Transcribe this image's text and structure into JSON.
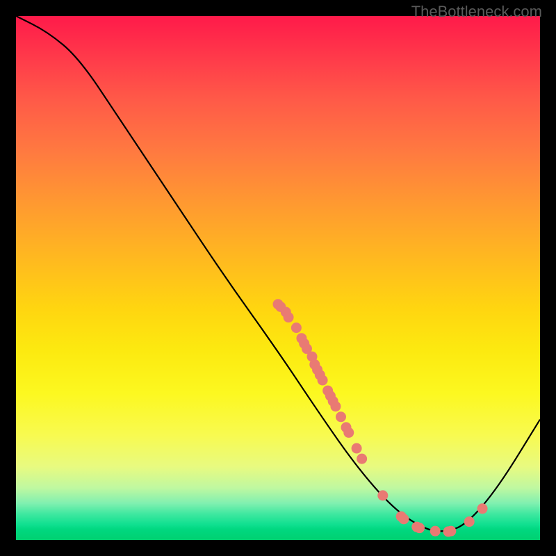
{
  "watermark": "TheBottleneck.com",
  "chart_data": {
    "type": "line",
    "title": "",
    "xlabel": "",
    "ylabel": "",
    "xlim": [
      0,
      100
    ],
    "ylim": [
      0,
      100
    ],
    "curve": [
      {
        "x": 0,
        "y": 100
      },
      {
        "x": 6,
        "y": 97
      },
      {
        "x": 12,
        "y": 92
      },
      {
        "x": 20,
        "y": 80
      },
      {
        "x": 30,
        "y": 65
      },
      {
        "x": 40,
        "y": 50
      },
      {
        "x": 50,
        "y": 36
      },
      {
        "x": 58,
        "y": 24
      },
      {
        "x": 65,
        "y": 14
      },
      {
        "x": 72,
        "y": 6
      },
      {
        "x": 78,
        "y": 2
      },
      {
        "x": 82,
        "y": 1.5
      },
      {
        "x": 86,
        "y": 3
      },
      {
        "x": 92,
        "y": 10
      },
      {
        "x": 100,
        "y": 23
      }
    ],
    "marker_points": [
      {
        "x": 50.0,
        "y": 45.0
      },
      {
        "x": 50.5,
        "y": 44.5
      },
      {
        "x": 51.5,
        "y": 43.5
      },
      {
        "x": 52.0,
        "y": 42.5
      },
      {
        "x": 53.5,
        "y": 40.5
      },
      {
        "x": 54.5,
        "y": 38.5
      },
      {
        "x": 55.0,
        "y": 37.5
      },
      {
        "x": 55.5,
        "y": 36.5
      },
      {
        "x": 56.5,
        "y": 35.0
      },
      {
        "x": 57.0,
        "y": 33.5
      },
      {
        "x": 57.5,
        "y": 32.5
      },
      {
        "x": 58.0,
        "y": 31.5
      },
      {
        "x": 58.5,
        "y": 30.5
      },
      {
        "x": 59.5,
        "y": 28.5
      },
      {
        "x": 60.0,
        "y": 27.5
      },
      {
        "x": 60.5,
        "y": 26.5
      },
      {
        "x": 61.0,
        "y": 25.5
      },
      {
        "x": 62.0,
        "y": 23.5
      },
      {
        "x": 63.0,
        "y": 21.5
      },
      {
        "x": 63.5,
        "y": 20.5
      },
      {
        "x": 65.0,
        "y": 17.5
      },
      {
        "x": 66.0,
        "y": 15.5
      },
      {
        "x": 70.0,
        "y": 8.5
      },
      {
        "x": 73.5,
        "y": 4.5
      },
      {
        "x": 74.0,
        "y": 4.0
      },
      {
        "x": 76.5,
        "y": 2.5
      },
      {
        "x": 77.0,
        "y": 2.3
      },
      {
        "x": 80.0,
        "y": 1.7
      },
      {
        "x": 82.5,
        "y": 1.6
      },
      {
        "x": 83.0,
        "y": 1.7
      },
      {
        "x": 86.5,
        "y": 3.5
      },
      {
        "x": 89.0,
        "y": 6.0
      }
    ],
    "marker_color": "#e97a73",
    "curve_color": "#000000"
  }
}
